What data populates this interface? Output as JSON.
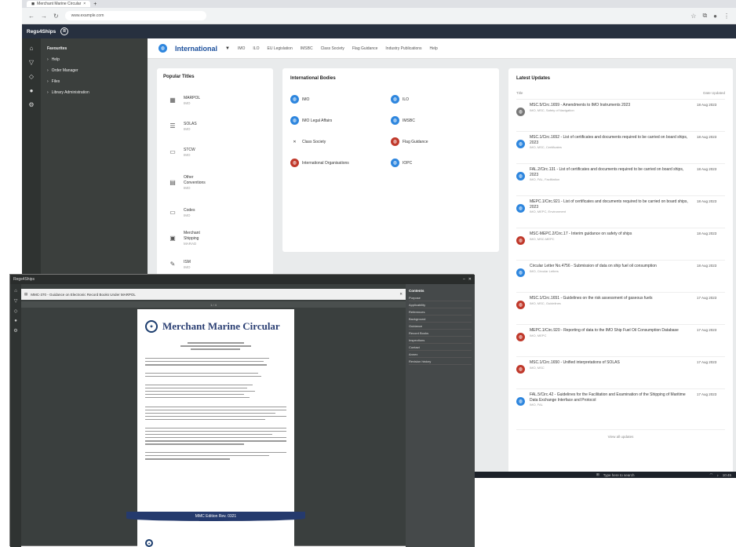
{
  "browser": {
    "tab_title": "Merchant Marine Circular",
    "url": "www.example.com"
  },
  "app": {
    "brand": "Regs4Ships",
    "logo_text": "R"
  },
  "sidebar": {
    "section_title": "Favourites",
    "items": [
      {
        "label": "Help"
      },
      {
        "label": "Order Manager"
      },
      {
        "label": "Files"
      },
      {
        "label": "Library Administration"
      }
    ]
  },
  "topnav": {
    "title": "International",
    "links": [
      "IMO",
      "ILO",
      "EU Legislation",
      "IMSBC",
      "Class Society",
      "Flag Guidance",
      "Industry Publications",
      "Help"
    ]
  },
  "popular": {
    "title": "Popular Titles",
    "items": [
      {
        "title": "MARPOL",
        "sub": "IMO",
        "icon": "book-icon"
      },
      {
        "title": "SOLAS",
        "sub": "IMO",
        "icon": "list-icon"
      },
      {
        "title": "STCW",
        "sub": "IMO",
        "icon": "cert-icon"
      },
      {
        "title": "Other Conventions",
        "sub": "IMO",
        "icon": "doc-icon"
      },
      {
        "title": "Codes",
        "sub": "IMO",
        "icon": "code-icon"
      },
      {
        "title": "Merchant Shipping",
        "sub": "MARAD",
        "icon": "ship-icon"
      },
      {
        "title": "ISM",
        "sub": "IMO",
        "icon": "pen-icon"
      }
    ]
  },
  "orgs": {
    "title": "International Bodies",
    "items": [
      {
        "label": "IMO",
        "color": "blue"
      },
      {
        "label": "ILO",
        "color": "blue"
      },
      {
        "label": "IMO Legal Affairs",
        "color": "blue"
      },
      {
        "label": "IMSBC",
        "color": "blue"
      },
      {
        "label": "Class Society",
        "color": "none"
      },
      {
        "label": "Flag Guidance",
        "color": "red"
      },
      {
        "label": "International Organisations",
        "color": "red"
      },
      {
        "label": "IOPC",
        "color": "blue"
      }
    ]
  },
  "latest": {
    "title": "Latest Updates",
    "col_title": "Title",
    "col_date": "Date Updated",
    "rows": [
      {
        "title": "MSC.5/Circ.1659 - Amendments to IMO Instruments 2023",
        "meta": "IMO, MSC, Safety of Navigation",
        "date": "18 Aug 2023",
        "color": "grey"
      },
      {
        "title": "MSC.1/Circ.1652 - List of certificates and documents required to be carried on board ships, 2023",
        "meta": "IMO, MSC, Certificates",
        "date": "18 Aug 2023",
        "color": "blue"
      },
      {
        "title": "FAL.2/Circ.131 - List of certificates and documents required to be carried on board ships, 2023",
        "meta": "IMO, FAL, Facilitation",
        "date": "18 Aug 2023",
        "color": "blue"
      },
      {
        "title": "MEPC.1/Circ.921 - List of certificates and documents required to be carried on board ships, 2023",
        "meta": "IMO, MEPC, Environment",
        "date": "18 Aug 2023",
        "color": "blue"
      },
      {
        "title": "MSC-MEPC.2/Circ.17 - Interim guidance on safety of ships",
        "meta": "IMO, MSC-MEPC",
        "date": "18 Aug 2023",
        "color": "red"
      },
      {
        "title": "Circular Letter No.4756 - Submission of data on ship fuel oil consumption",
        "meta": "IMO, Circular Letters",
        "date": "18 Aug 2023",
        "color": "blue"
      },
      {
        "title": "MSC.1/Circ.1651 - Guidelines on the risk assessment of gaseous fuels",
        "meta": "IMO, MSC, Guidelines",
        "date": "17 Aug 2023",
        "color": "red"
      },
      {
        "title": "MEPC.1/Circ.920 - Reporting of data to the IMO Ship Fuel Oil Consumption Database",
        "meta": "IMO, MEPC",
        "date": "17 Aug 2023",
        "color": "red"
      },
      {
        "title": "MSC.1/Circ.1650 - Unified interpretations of SOLAS",
        "meta": "IMO, MSC",
        "date": "17 Aug 2023",
        "color": "red"
      },
      {
        "title": "FAL.5/Circ.42 - Guidelines for the Facilitation and Examination of the Shipping of Maritime Data Exchange Interface and Protocol",
        "meta": "IMO, FAL",
        "date": "17 Aug 2023",
        "color": "blue"
      }
    ],
    "view_all": "View all updates"
  },
  "viewer": {
    "window_title": "Regs4Ships",
    "doc_path": "MMC-370 - Guidance on Electronic Record Books Under MARPOL",
    "page_indicator": "1 / 4",
    "doc_title": "Merchant Marine Circular",
    "banner": "MMC Edition Rev. 0321",
    "side_title": "Contents",
    "side_items": [
      "Purpose",
      "Applicability",
      "References",
      "Background",
      "Guidance",
      "Record Books",
      "Inspections",
      "Contact",
      "Annex",
      "Revision history"
    ]
  },
  "taskbar": {
    "search": "Type here to search",
    "time": "10:45"
  }
}
